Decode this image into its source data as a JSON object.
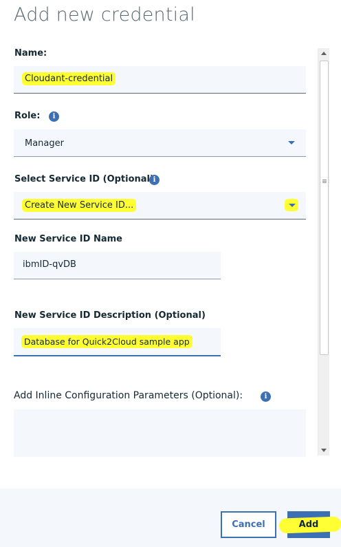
{
  "dialog": {
    "title": "Add new credential"
  },
  "form": {
    "name_label": "Name:",
    "name_value": "Cloudant-credential",
    "role_label": "Role:",
    "role_value": "Manager",
    "service_id_label": "Select Service ID (Optional)",
    "service_id_value": "Create New Service ID...",
    "new_service_id_name_label": "New Service ID Name",
    "new_service_id_name_value": "ibmID-qvDB",
    "new_service_id_desc_label": "New Service ID Description (Optional)",
    "new_service_id_desc_value": "Database for Quick2Cloud sample app",
    "inline_params_label": "Add Inline Configuration Parameters (Optional):",
    "info_glyph": "i"
  },
  "footer": {
    "cancel_label": "Cancel",
    "add_label": "Add"
  },
  "colors": {
    "accent": "#3d70b2",
    "highlight": "#ffff33",
    "field_bg": "#f4f7fb"
  },
  "icons": [
    "info-icon",
    "chevron-down-icon",
    "scroll-up-icon",
    "scroll-down-icon"
  ]
}
